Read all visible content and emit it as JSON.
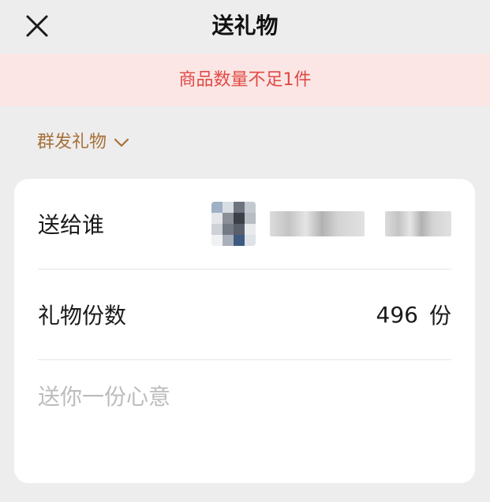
{
  "header": {
    "title": "送礼物"
  },
  "banner": {
    "warning_text": "商品数量不足1件"
  },
  "group_send": {
    "label": "群发礼物"
  },
  "recipient": {
    "label": "送给谁"
  },
  "quantity": {
    "label": "礼物份数",
    "value": "496",
    "unit": "份"
  },
  "message": {
    "placeholder": "送你一份心意"
  },
  "colors": {
    "background": "#ededed",
    "banner_bg": "#fbe6e5",
    "warning_text": "#e04a45",
    "group_send_text": "#a7703a",
    "card_bg": "#ffffff",
    "placeholder": "#bcbcbc"
  },
  "icons": {
    "close": "close-icon",
    "dropdown": "chevron-down-icon"
  }
}
